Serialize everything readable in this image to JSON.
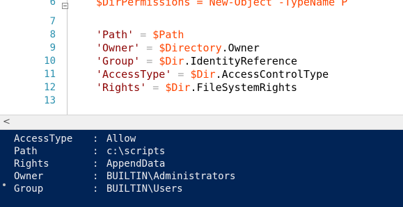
{
  "editor": {
    "lines": [
      {
        "num": "6",
        "parts": [
          {
            "t": "$DirPermissions = New-Object -TypeName P",
            "c": "var"
          }
        ]
      },
      {
        "num": "7",
        "parts": []
      },
      {
        "num": "8",
        "parts": [
          {
            "t": "'Path'",
            "c": "str"
          },
          {
            "t": " = ",
            "c": "op"
          },
          {
            "t": "$Path",
            "c": "var"
          }
        ]
      },
      {
        "num": "9",
        "parts": [
          {
            "t": "'Owner'",
            "c": "str"
          },
          {
            "t": " = ",
            "c": "op"
          },
          {
            "t": "$Directory",
            "c": "var"
          },
          {
            "t": ".Owner",
            "c": "prop"
          }
        ]
      },
      {
        "num": "10",
        "parts": [
          {
            "t": "'Group'",
            "c": "str"
          },
          {
            "t": " = ",
            "c": "op"
          },
          {
            "t": "$Dir",
            "c": "var"
          },
          {
            "t": ".IdentityReference",
            "c": "prop"
          }
        ]
      },
      {
        "num": "11",
        "parts": [
          {
            "t": "'AccessType'",
            "c": "str"
          },
          {
            "t": " = ",
            "c": "op"
          },
          {
            "t": "$Dir",
            "c": "var"
          },
          {
            "t": ".AccessControlType",
            "c": "prop"
          }
        ]
      },
      {
        "num": "12",
        "parts": [
          {
            "t": "'Rights'",
            "c": "str"
          },
          {
            "t": " = ",
            "c": "op"
          },
          {
            "t": "$Dir",
            "c": "var"
          },
          {
            "t": ".FileSystemRights",
            "c": "prop"
          }
        ]
      },
      {
        "num": "13",
        "parts": []
      }
    ]
  },
  "scrollbar": {
    "left_arrow": "<"
  },
  "console": {
    "rows": [
      {
        "key": "AccessType",
        "sep": ":",
        "value": "Allow"
      },
      {
        "key": "Path",
        "sep": ":",
        "value": "c:\\scripts"
      },
      {
        "key": "Rights",
        "sep": ":",
        "value": "AppendData"
      },
      {
        "key": "Owner",
        "sep": ":",
        "value": "BUILTIN\\Administrators"
      },
      {
        "key": "Group",
        "sep": ":",
        "value": "BUILTIN\\Users"
      }
    ]
  },
  "colors": {
    "console_bg": "#012456",
    "console_fg": "#eeedf0",
    "string": "#8b0000",
    "variable": "#ff4500",
    "line_number": "#2b91af"
  }
}
